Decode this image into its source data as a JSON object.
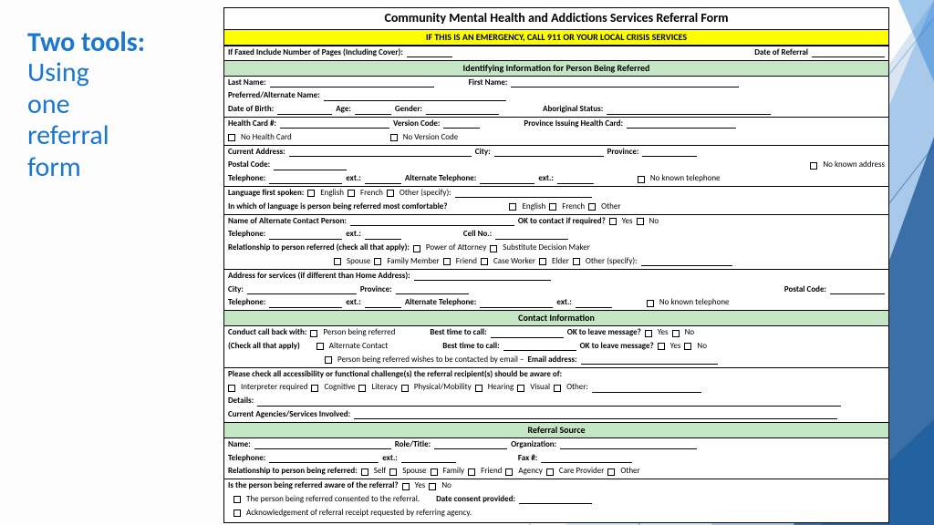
{
  "slide_title_bold": "Two tools:",
  "slide_title_rest": "Using\none\nreferral\nform",
  "form": {
    "title": "Community Mental Health and Addictions Services Referral Form",
    "emergency": "IF THIS IS AN EMERGENCY, CALL 911 OR YOUR LOCAL CRISIS SERVICES",
    "fax_line_a": "If Faxed Include Number of Pages (Including Cover):",
    "fax_line_b": "Date of Referral",
    "sect_ident": "Identifying Information for Person Being Referred",
    "last_name": "Last Name:",
    "first_name": "First Name:",
    "pref_name": "Preferred/Alternate Name:",
    "dob": "Date of Birth:",
    "age": "Age:",
    "gender": "Gender:",
    "aborig": "Aboriginal Status:",
    "health_card": "Health Card #:",
    "version": "Version Code:",
    "province_card": "Province Issuing Health Card:",
    "no_health": "No Health Card",
    "no_version": "No Version Code",
    "address": "Current Address:",
    "city": "City:",
    "province": "Province:",
    "postal": "Postal Code:",
    "no_addr": "No known address",
    "tele": "Telephone:",
    "ext": "ext.:",
    "alt_tele": "Alternate Telephone:",
    "no_tele": "No known telephone",
    "lang_first": "Language first spoken:",
    "english": "English",
    "french": "French",
    "other_spec": "Other (specify):",
    "other": "Other",
    "lang_comf": "In which of language is person being referred most comfortable?",
    "alt_contact": "Name of Alternate Contact Person:",
    "ok_contact": "OK to contact if required?",
    "yes": "Yes",
    "no": "No",
    "cell": "Cell No.:",
    "relation": "Relationship to person referred (check all that apply):",
    "poa": "Power of Attorney",
    "sdm": "Substitute Decision Maker",
    "spouse": "Spouse",
    "family_m": "Family Member",
    "friend": "Friend",
    "case_w": "Case Worker",
    "elder": "Elder",
    "addr_serv": "Address for services (if different than Home Address):",
    "sect_contact": "Contact Information",
    "callback": "Conduct call back with:",
    "check_all": "(Check all that apply)",
    "person_ref": "Person being referred",
    "alt_c": "Alternate Contact",
    "best_time": "Best time to call:",
    "ok_msg": "OK to leave message?",
    "email_pref": "Person being referred wishes to be contacted by email –",
    "email_addr": "Email address:",
    "access": "Please check all accessibility or functional challenge(s) the referral recipient(s) should be aware of:",
    "interp": "Interpreter required",
    "cognitive": "Cognitive",
    "literacy": "Literacy",
    "physical": "Physical/Mobility",
    "hearing": "Hearing",
    "visual": "Visual",
    "other_l": "Other:",
    "details": "Details:",
    "agencies": "Current Agencies/Services Involved:",
    "sect_source": "Referral Source",
    "name": "Name:",
    "role": "Role/Title:",
    "org": "Organization:",
    "fax": "Fax #:",
    "rel_being": "Relationship to person being referred:",
    "self": "Self",
    "family": "Family",
    "agency": "Agency",
    "care": "Care Provider",
    "aware": "Is the person being referred aware of the referral?",
    "consent": "The person being referred consented to the referral.",
    "date_consent": "Date consent provided:",
    "ack": "Acknowledgement of referral receipt requested by referring agency."
  }
}
